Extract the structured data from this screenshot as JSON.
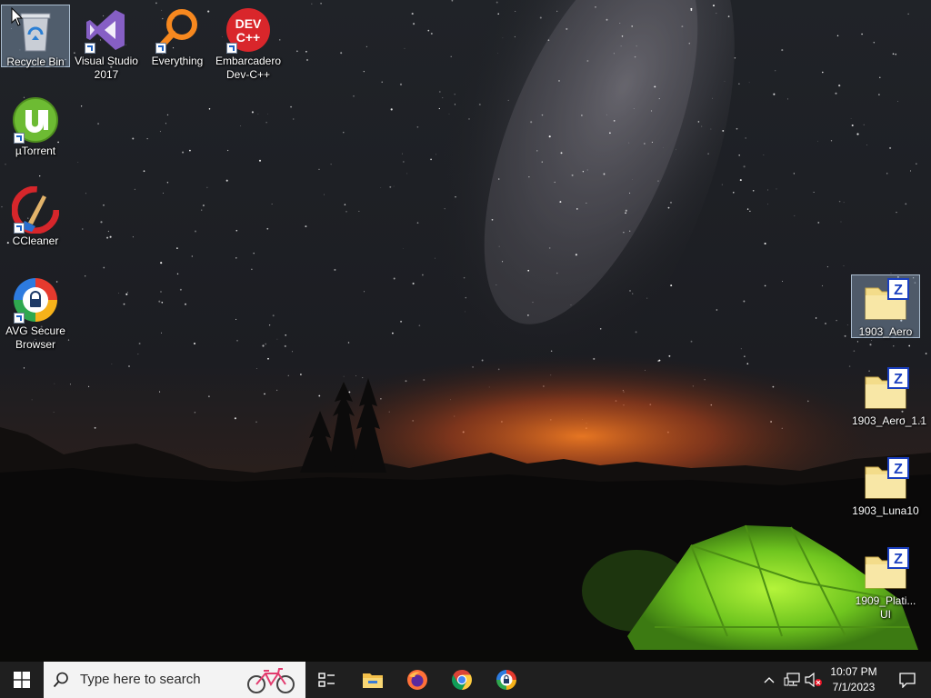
{
  "desktop": {
    "left_icons": [
      {
        "label": "Recycle Bin",
        "icon": "recycle-bin-icon",
        "selected": true
      },
      {
        "label": "Visual Studio 2017",
        "icon": "visual-studio-icon"
      },
      {
        "label": "Everything",
        "icon": "everything-search-icon"
      },
      {
        "label": "Embarcadero Dev-C++",
        "icon": "dev-cpp-icon",
        "icon_text_1": "DEV",
        "icon_text_2": "C++"
      },
      {
        "label": "µTorrent",
        "icon": "utorrent-icon"
      },
      {
        "label": "CCleaner",
        "icon": "ccleaner-icon"
      },
      {
        "label": "AVG Secure Browser",
        "icon": "avg-browser-icon"
      }
    ],
    "right_icons": [
      {
        "label": "1903_Aero",
        "icon": "zip-folder-icon",
        "badge": "Z",
        "selected": true
      },
      {
        "label": "1903_Aero_1.1",
        "icon": "zip-folder-icon",
        "badge": "Z"
      },
      {
        "label": "1903_Luna10",
        "icon": "zip-folder-icon",
        "badge": "Z"
      },
      {
        "label": "1909_Plati... UI",
        "icon": "zip-folder-icon",
        "badge": "Z"
      }
    ]
  },
  "taskbar": {
    "search_placeholder": "Type here to search",
    "pinned": [
      "start-icon",
      "task-view-icon",
      "file-explorer-icon",
      "firefox-icon",
      "chrome-icon",
      "avg-browser-icon"
    ],
    "tray": [
      "show-hidden-icons-chevron",
      "network-icon",
      "volume-muted-icon"
    ],
    "time": "10:07 PM",
    "date": "7/1/2023"
  },
  "colors": {
    "taskbar": "#1f1f1f",
    "tent_green": "#7ed321",
    "sky": "#1b1d22",
    "horizon_glow": "#e0581a"
  }
}
